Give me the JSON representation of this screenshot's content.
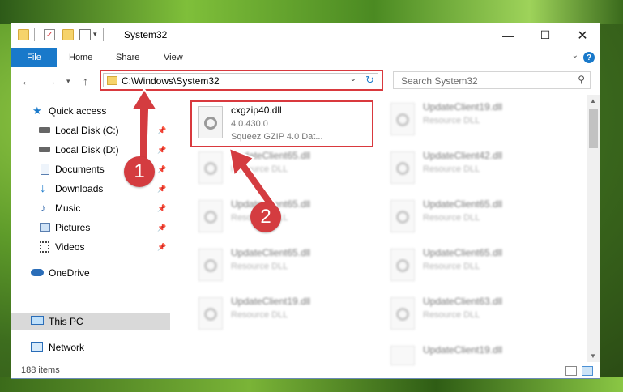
{
  "window": {
    "title": "System32"
  },
  "ribbon": {
    "tabs": [
      "File",
      "Home",
      "Share",
      "View"
    ],
    "help": "?"
  },
  "navigation": {
    "address_path": "C:\\Windows\\System32",
    "search_placeholder": "Search System32"
  },
  "sidebar": {
    "items": [
      {
        "label": "Quick access",
        "icon": "star-icon",
        "pinned": false
      },
      {
        "label": "Local Disk (C:)",
        "icon": "drive-icon",
        "pinned": true
      },
      {
        "label": "Local Disk (D:)",
        "icon": "drive-icon",
        "pinned": true
      },
      {
        "label": "Documents",
        "icon": "documents-icon",
        "pinned": true
      },
      {
        "label": "Downloads",
        "icon": "download-icon",
        "pinned": true
      },
      {
        "label": "Music",
        "icon": "music-icon",
        "pinned": true
      },
      {
        "label": "Pictures",
        "icon": "pictures-icon",
        "pinned": true
      },
      {
        "label": "Videos",
        "icon": "videos-icon",
        "pinned": true
      },
      {
        "label": "OneDrive",
        "icon": "cloud-icon",
        "pinned": false
      },
      {
        "label": "This PC",
        "icon": "computer-icon",
        "pinned": false,
        "selected": true
      },
      {
        "label": "Network",
        "icon": "network-icon",
        "pinned": false
      }
    ]
  },
  "files": {
    "highlighted": {
      "name": "cxgzip40.dll",
      "version": "4.0.430.0",
      "description": "Squeez GZIP 4.0 Dat..."
    },
    "left_blurred": [
      {
        "name": "UpdateClient65.dll",
        "type": "Resource DLL"
      },
      {
        "name": "UpdateClient65.dll",
        "type": "Resource DLL"
      },
      {
        "name": "UpdateClient65.dll",
        "type": "Resource DLL"
      },
      {
        "name": "UpdateClient19.dll",
        "type": "Resource DLL"
      }
    ],
    "right_blurred": [
      {
        "name": "UpdateClient19.dll",
        "type": "Resource DLL"
      },
      {
        "name": "UpdateClient42.dll",
        "type": "Resource DLL"
      },
      {
        "name": "UpdateClient65.dll",
        "type": "Resource DLL"
      },
      {
        "name": "UpdateClient65.dll",
        "type": "Resource DLL"
      },
      {
        "name": "UpdateClient63.dll",
        "type": "Resource DLL"
      },
      {
        "name": "UpdateClient19.dll",
        "type": "Resource DLL"
      }
    ]
  },
  "status": {
    "items_count": "188 items"
  },
  "callouts": {
    "one": "1",
    "two": "2"
  },
  "colors": {
    "accent": "#1979ca",
    "highlight": "#d9393e",
    "callout": "#d43c40"
  }
}
